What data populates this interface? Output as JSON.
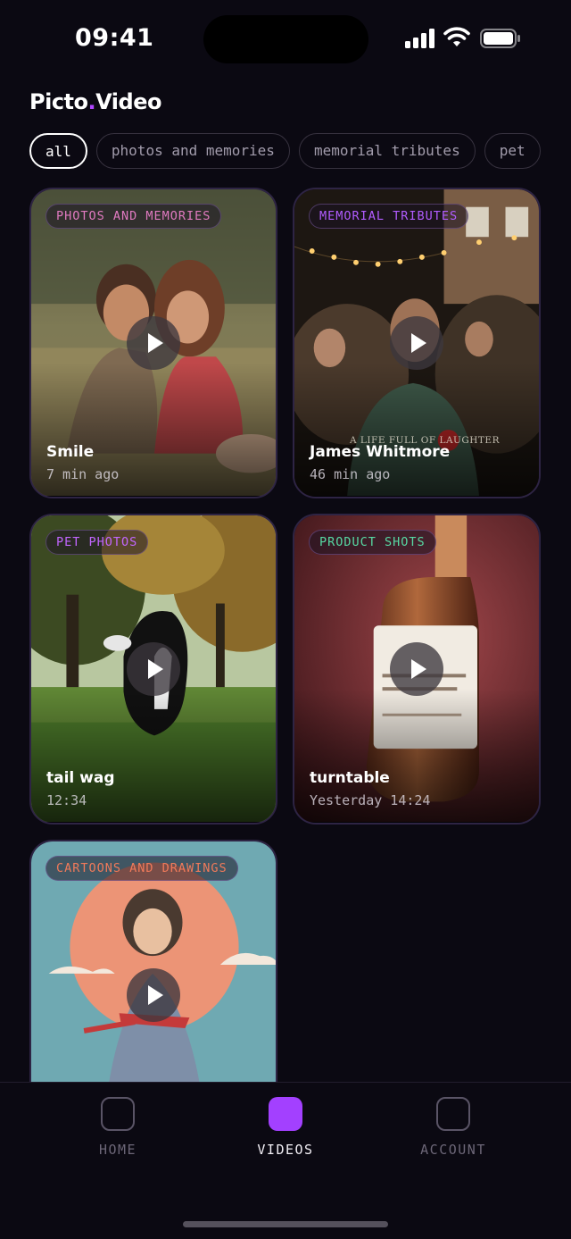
{
  "status_bar": {
    "time": "09:41"
  },
  "brand": {
    "name_part1": "Picto",
    "dot": ".",
    "name_part2": "Video"
  },
  "filters": [
    {
      "label": "all",
      "active": true
    },
    {
      "label": "photos and memories",
      "active": false
    },
    {
      "label": "memorial tributes",
      "active": false
    },
    {
      "label": "pet",
      "active": false
    }
  ],
  "videos": [
    {
      "tag": "PHOTOS AND MEMORIES",
      "tag_color": "#e07ac0",
      "title": "Smile",
      "meta": "7 min ago"
    },
    {
      "tag": "MEMORIAL TRIBUTES",
      "tag_color": "#b15cff",
      "title": "James Whitmore",
      "meta": "46 min ago",
      "overlay_text": "A LIFE FULL OF LAUGHTER"
    },
    {
      "tag": "PET PHOTOS",
      "tag_color": "#c266ff",
      "title": "tail wag",
      "meta": "12:34"
    },
    {
      "tag": "PRODUCT SHOTS",
      "tag_color": "#57d9a3",
      "title": "turntable",
      "meta": "Yesterday 14:24"
    },
    {
      "tag": "CARTOONS AND DRAWINGS",
      "tag_color": "#f07a5a",
      "title": "",
      "meta": ""
    }
  ],
  "nav": [
    {
      "label": "HOME",
      "icon": "home-icon",
      "active": false
    },
    {
      "label": "VIDEOS",
      "icon": "videos-icon",
      "active": true
    },
    {
      "label": "ACCOUNT",
      "icon": "account-icon",
      "active": false
    }
  ],
  "colors": {
    "accent": "#a340ff",
    "background": "#0b0912"
  }
}
